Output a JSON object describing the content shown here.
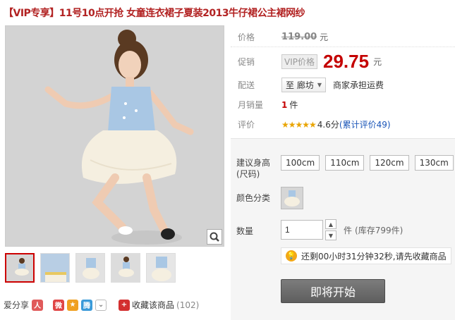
{
  "title": "【VIP专享】11号10点开抢 女童连衣裙子夏装2013牛仔裙公主裙网纱",
  "price": {
    "label": "价格",
    "original": "119.00",
    "unit": "元"
  },
  "promo": {
    "label": "促销",
    "tag": "VIP价格",
    "price": "29.75",
    "unit": "元"
  },
  "delivery": {
    "label": "配送",
    "destination": "至 廊坊",
    "note": "商家承担运费"
  },
  "monthly_sales": {
    "label": "月销量",
    "count": "1",
    "unit": "件"
  },
  "rating": {
    "label": "评价",
    "stars": "★★★★★",
    "score": "4.6分",
    "link": "(累计评价49)"
  },
  "spec": {
    "size_label_line1": "建议身高",
    "size_label_line2": "(尺码)",
    "sizes": [
      "100cm",
      "110cm",
      "120cm",
      "130cm"
    ],
    "color_label": "颜色分类",
    "qty_label": "数量",
    "qty_value": "1",
    "qty_unit": "件",
    "stock": "(库存799件)",
    "timer_text": "还剩00小时31分钟32秒,请先收藏商品",
    "buy_button": "即将开始"
  },
  "share": {
    "label": "爱分享",
    "fav_label": "收藏该商品",
    "fav_count": "(102)"
  },
  "colors": {
    "title": "#b22222",
    "price": "#c40000",
    "star": "#e9a400",
    "link": "#1a55b8",
    "buy_button": "#6a6a6a"
  }
}
